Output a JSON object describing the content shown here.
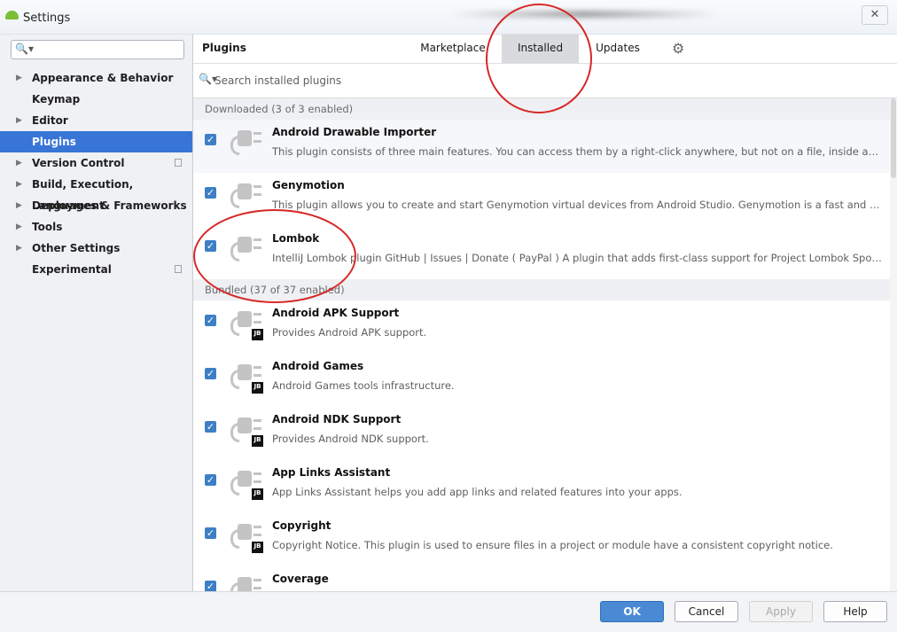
{
  "window": {
    "title": "Settings",
    "close_glyph": "✕"
  },
  "sidebar": {
    "search_glyph": "🔍▾",
    "items": [
      {
        "label": "Appearance & Behavior",
        "arrow": "▶",
        "copy": false
      },
      {
        "label": "Keymap",
        "arrow": "",
        "copy": false
      },
      {
        "label": "Editor",
        "arrow": "▶",
        "copy": false
      },
      {
        "label": "Plugins",
        "arrow": "",
        "copy": false,
        "selected": true
      },
      {
        "label": "Version Control",
        "arrow": "▶",
        "copy": true
      },
      {
        "label": "Build, Execution, Deployment",
        "arrow": "▶",
        "copy": false
      },
      {
        "label": "Languages & Frameworks",
        "arrow": "▶",
        "copy": false
      },
      {
        "label": "Tools",
        "arrow": "▶",
        "copy": false
      },
      {
        "label": "Other Settings",
        "arrow": "▶",
        "copy": false
      },
      {
        "label": "Experimental",
        "arrow": "",
        "copy": true
      }
    ]
  },
  "main": {
    "title": "Plugins",
    "tabs": [
      {
        "label": "Marketplace"
      },
      {
        "label": "Installed",
        "active": true
      },
      {
        "label": "Updates"
      }
    ],
    "gear_glyph": "⚙",
    "search_glyph": "🔍▾",
    "search_placeholder": "Search installed plugins",
    "downloaded_header": "Downloaded (3 of 3 enabled)",
    "bundled_header": "Bundled (37 of 37 enabled)",
    "downloaded": [
      {
        "name": "Android Drawable Importer",
        "desc": "This plugin consists of three main features. You can access them by a right-click anywhere, but not on a file, inside an Android...",
        "checked": true,
        "jb": false
      },
      {
        "name": "Genymotion",
        "desc": "This plugin allows you to create and start Genymotion virtual devices from Android Studio. Genymotion is a fast and easy-to-use...",
        "checked": true,
        "jb": false
      },
      {
        "name": "Lombok",
        "desc": "IntelliJ Lombok plugin GitHub | Issues | Donate ( PayPal ) A plugin that adds first-class support for Project Lombok Sponsors...",
        "checked": true,
        "jb": false
      }
    ],
    "bundled": [
      {
        "name": "Android APK Support",
        "desc": "Provides Android APK support.",
        "checked": true,
        "jb": true
      },
      {
        "name": "Android Games",
        "desc": "Android Games tools infrastructure.",
        "checked": true,
        "jb": true
      },
      {
        "name": "Android NDK Support",
        "desc": "Provides Android NDK support.",
        "checked": true,
        "jb": true
      },
      {
        "name": "App Links Assistant",
        "desc": "App Links Assistant helps you add app links and related features into your apps.",
        "checked": true,
        "jb": true
      },
      {
        "name": "Copyright",
        "desc": "Copyright Notice. This plugin is used to ensure files in a project or module have a consistent copyright notice.",
        "checked": true,
        "jb": true
      },
      {
        "name": "Coverage",
        "desc": "",
        "checked": true,
        "jb": true
      }
    ],
    "check_glyph": "✓",
    "jb_badge": "JB"
  },
  "footer": {
    "ok": "OK",
    "cancel": "Cancel",
    "apply": "Apply",
    "help": "Help"
  },
  "colors": {
    "selection": "#3875d7",
    "checkbox": "#3d7fc5",
    "annotation": "#d62828",
    "primary_button": "#4a8ad4"
  }
}
